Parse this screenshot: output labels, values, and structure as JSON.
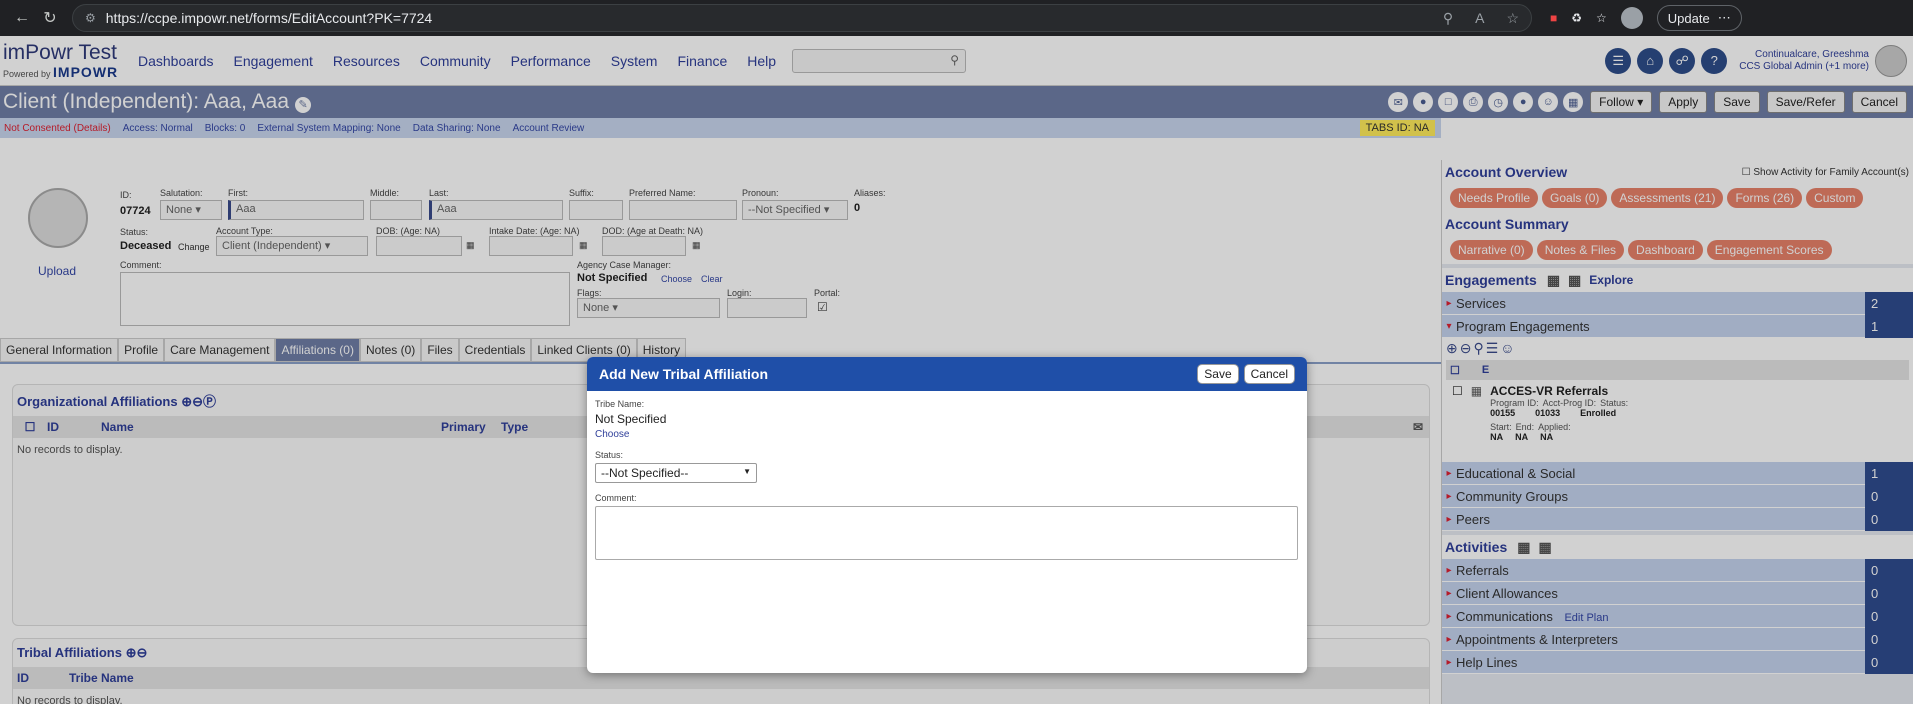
{
  "browser": {
    "url": "https://ccpe.impowr.net/forms/EditAccount?PK=7724",
    "update_label": "Update"
  },
  "app": {
    "title": "imPowr Test",
    "powered": "Powered by",
    "brand": "IMPOWR",
    "menu": [
      "Dashboards",
      "Engagement",
      "Resources",
      "Community",
      "Performance",
      "System",
      "Finance",
      "Help"
    ],
    "user_name": "Continualcare, Greeshma",
    "user_role": "CCS Global Admin (+1 more)"
  },
  "titlebar": {
    "title": "Client (Independent): Aaa, Aaa",
    "follow": "Follow",
    "apply": "Apply",
    "save": "Save",
    "save_refer": "Save/Refer",
    "cancel": "Cancel"
  },
  "infobar": {
    "consent": "Not Consented (Details)",
    "access": "Access: Normal",
    "blocks": "Blocks: 0",
    "ext": "External System Mapping: None",
    "sharing": "Data Sharing: None",
    "review": "Account Review",
    "tabs_id": "TABS ID: NA"
  },
  "form": {
    "upload": "Upload",
    "id_label": "ID:",
    "id": "07724",
    "salutation_label": "Salutation:",
    "salutation": "None",
    "first_label": "First:",
    "first": "Aaa",
    "middle_label": "Middle:",
    "last_label": "Last:",
    "last": "Aaa",
    "suffix_label": "Suffix:",
    "preferred_label": "Preferred Name:",
    "pronoun_label": "Pronoun:",
    "pronoun": "--Not Specified",
    "aliases_label": "Aliases:",
    "aliases": "0",
    "status_label": "Status:",
    "status": "Deceased",
    "change": "Change",
    "acct_type_label": "Account Type:",
    "acct_type": "Client (Independent)",
    "dob_label": "DOB: (Age: NA)",
    "intake_label": "Intake Date: (Age: NA)",
    "dod_label": "DOD: (Age at Death: NA)",
    "comment_label": "Comment:",
    "acm_label": "Agency Case Manager:",
    "acm": "Not Specified",
    "choose": "Choose",
    "clear": "Clear",
    "flags_label": "Flags:",
    "flags": "None",
    "login_label": "Login:",
    "portal_label": "Portal:"
  },
  "tabs": [
    "General Information",
    "Profile",
    "Care Management",
    "Affiliations (0)",
    "Notes (0)",
    "Files",
    "Credentials",
    "Linked Clients (0)",
    "History"
  ],
  "org": {
    "title": "Organizational Affiliations",
    "cols": [
      "ID",
      "Name",
      "Primary",
      "Type"
    ],
    "empty": "No records to display."
  },
  "tribal": {
    "title": "Tribal Affiliations",
    "cols": [
      "ID",
      "Tribe Name"
    ],
    "empty": "No records to display."
  },
  "right": {
    "overview": "Account Overview",
    "show_family": "Show Activity for Family Account(s)",
    "overview_pills": [
      "Needs Profile",
      "Goals (0)",
      "Assessments (21)",
      "Forms (26)",
      "Custom"
    ],
    "summary": "Account Summary",
    "summary_pills": [
      "Narrative (0)",
      "Notes & Files",
      "Dashboard",
      "Engagement Scores"
    ],
    "engagements": "Engagements",
    "explore": "Explore",
    "eng_rows": [
      {
        "label": "Services",
        "count": "2"
      },
      {
        "label": "Program Engagements",
        "count": "1"
      }
    ],
    "prog_col": "E",
    "prog_name": "ACCES-VR Referrals",
    "prog_id_lbl": "Program ID:",
    "prog_id": "00155",
    "acct_id_lbl": "Acct-Prog ID:",
    "acct_id": "01033",
    "status_lbl": "Status:",
    "status": "Enrolled",
    "start_lbl": "Start:",
    "start": "NA",
    "end_lbl": "End:",
    "end": "NA",
    "applied_lbl": "Applied:",
    "applied": "NA",
    "eng_rows2": [
      {
        "label": "Educational & Social",
        "count": "1"
      },
      {
        "label": "Community Groups",
        "count": "0"
      },
      {
        "label": "Peers",
        "count": "0"
      }
    ],
    "activities": "Activities",
    "act_rows": [
      {
        "label": "Referrals",
        "count": "0"
      },
      {
        "label": "Client Allowances",
        "count": "0"
      },
      {
        "label": "Communications",
        "count": "0",
        "extra": "Edit Plan"
      },
      {
        "label": "Appointments & Interpreters",
        "count": "0"
      },
      {
        "label": "Help Lines",
        "count": "0"
      }
    ]
  },
  "modal": {
    "title": "Add New Tribal Affiliation",
    "save": "Save",
    "cancel": "Cancel",
    "tribe_label": "Tribe Name:",
    "tribe": "Not Specified",
    "choose": "Choose",
    "status_label": "Status:",
    "status": "--Not Specified--",
    "comment_label": "Comment:"
  }
}
